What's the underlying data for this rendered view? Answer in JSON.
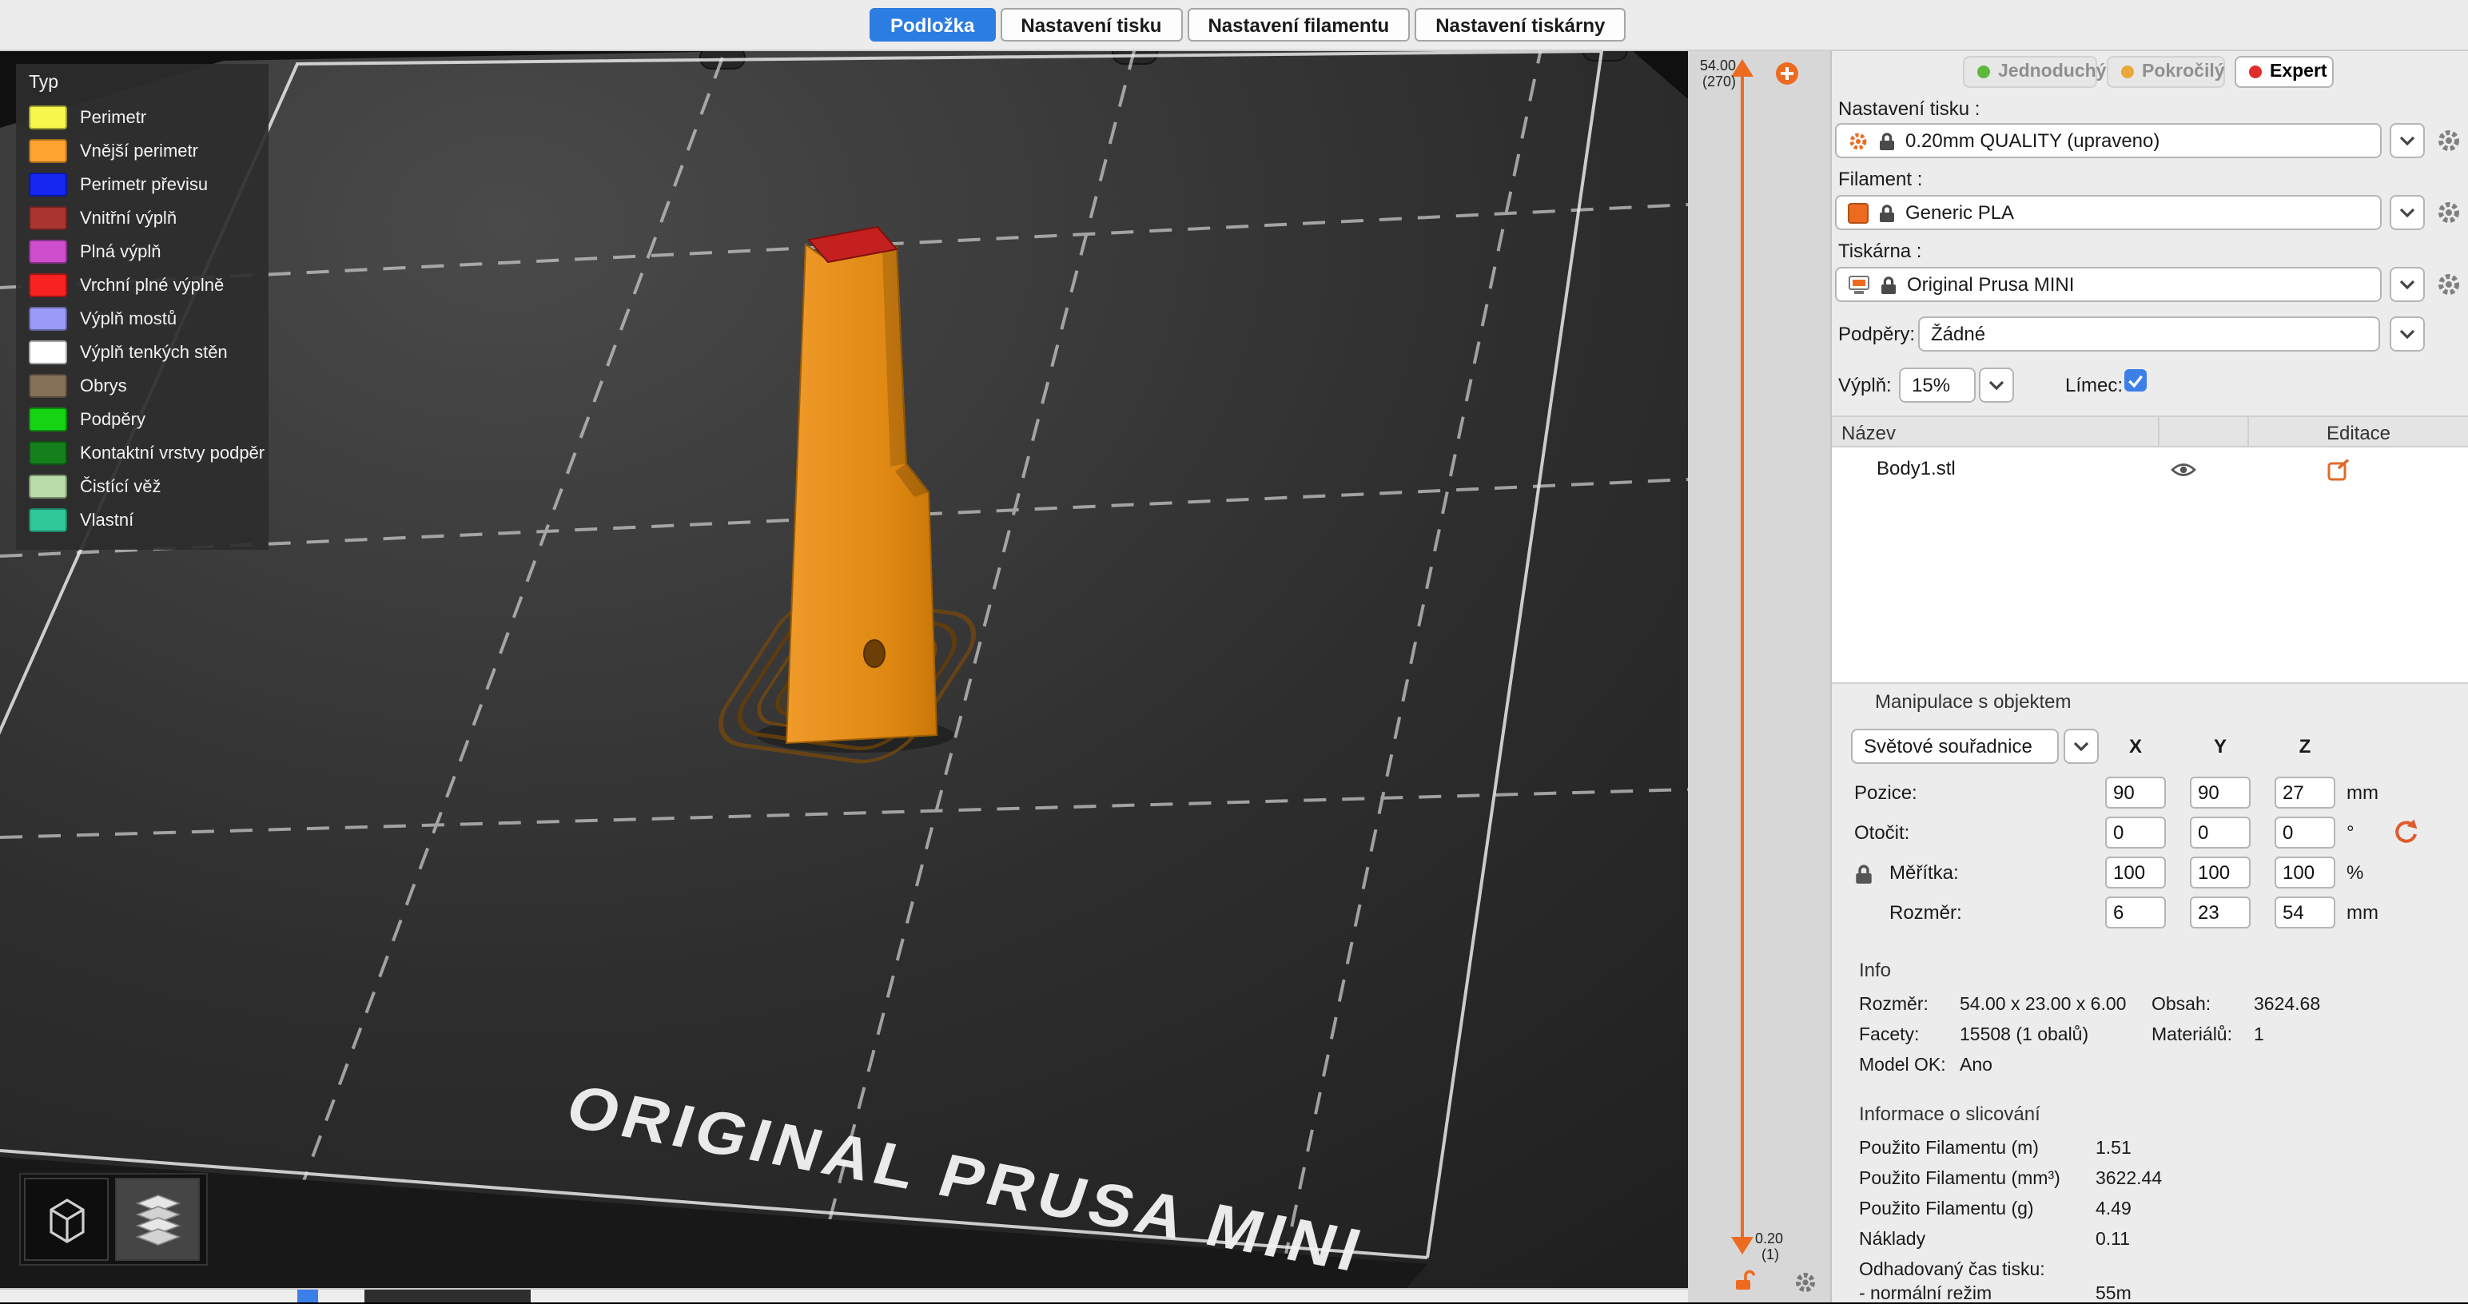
{
  "tabs": [
    {
      "label": "Podložka"
    },
    {
      "label": "Nastavení tisku"
    },
    {
      "label": "Nastavení filamentu"
    },
    {
      "label": "Nastavení tiskárny"
    }
  ],
  "viewport": {
    "bed_text": "ORIGINAL PRUSA MINI"
  },
  "legend": {
    "title": "Typ",
    "items": [
      {
        "label": "Perimetr",
        "color": "#F6F64C"
      },
      {
        "label": "Vnější perimetr",
        "color": "#FFA42E"
      },
      {
        "label": "Perimetr převisu",
        "color": "#1426F0"
      },
      {
        "label": "Vnitřní výplň",
        "color": "#A8352F"
      },
      {
        "label": "Plná výplň",
        "color": "#CE4ECE"
      },
      {
        "label": "Vrchní plné výplně",
        "color": "#F82222"
      },
      {
        "label": "Výplň mostů",
        "color": "#9A9AF8"
      },
      {
        "label": "Výplň tenkých stěn",
        "color": "#FFFFFF"
      },
      {
        "label": "Obrys",
        "color": "#857058"
      },
      {
        "label": "Podpěry",
        "color": "#14D414"
      },
      {
        "label": "Kontaktní vrstvy podpěr",
        "color": "#14801C"
      },
      {
        "label": "Čistící věž",
        "color": "#B8DCA8"
      },
      {
        "label": "Vlastní",
        "color": "#30C898"
      }
    ]
  },
  "layer_slider": {
    "top_value": "54.00",
    "top_layer": "(270)",
    "bottom_value": "0.20",
    "bottom_layer": "(1)"
  },
  "modes": {
    "simple": {
      "label": "Jednoduchý",
      "color": "#5FB83C"
    },
    "advanced": {
      "label": "Pokročilý",
      "color": "#E9A83A"
    },
    "expert": {
      "label": "Expert",
      "color": "#E02D2D"
    }
  },
  "presets": {
    "print": {
      "label": "Nastavení tisku :",
      "value": "0.20mm QUALITY (upraveno)"
    },
    "filament": {
      "label": "Filament :",
      "value": "Generic PLA",
      "swatch": "#ED6B21"
    },
    "printer": {
      "label": "Tiskárna :",
      "value": "Original Prusa MINI"
    }
  },
  "supports": {
    "label": "Podpěry:",
    "value": "Žádné"
  },
  "infill": {
    "label": "Výplň:",
    "value": "15%"
  },
  "brim": {
    "label": "Límec:"
  },
  "object_list": {
    "headers": {
      "name": "Název",
      "edit": "Editace"
    },
    "rows": [
      {
        "name": "Body1.stl"
      }
    ]
  },
  "manipulation": {
    "title": "Manipulace s objektem",
    "coord_system": "Světové souřadnice",
    "axes": [
      "X",
      "Y",
      "Z"
    ],
    "rows": [
      {
        "label": "Pozice:",
        "x": "90",
        "y": "90",
        "z": "27",
        "unit": "mm"
      },
      {
        "label": "Otočit:",
        "x": "0",
        "y": "0",
        "z": "0",
        "unit": "°"
      },
      {
        "label": "Měřítka:",
        "x": "100",
        "y": "100",
        "z": "100",
        "unit": "%"
      },
      {
        "label": "Rozměr:",
        "x": "6",
        "y": "23",
        "z": "54",
        "unit": "mm"
      }
    ]
  },
  "info": {
    "title": "Info",
    "size_label": "Rozměr:",
    "size_value": "54.00 x 23.00 x 6.00",
    "volume_label": "Obsah:",
    "volume_value": "3624.68",
    "facets_label": "Facety:",
    "facets_value": "15508 (1 obalů)",
    "materials_label": "Materiálů:",
    "materials_value": "1",
    "model_ok_label": "Model OK:",
    "model_ok_value": "Ano"
  },
  "slicing": {
    "title": "Informace o slicování",
    "rows": [
      {
        "label": "Použito Filamentu (m)",
        "value": "1.51"
      },
      {
        "label": "Použito Filamentu (mm³)",
        "value": "3622.44"
      },
      {
        "label": "Použito Filamentu (g)",
        "value": "4.49"
      },
      {
        "label": "Náklady",
        "value": "0.11"
      },
      {
        "label": "Odhadovaný čas tisku:",
        "value": ""
      },
      {
        "label": "- normální režim",
        "value": "55m"
      }
    ]
  }
}
